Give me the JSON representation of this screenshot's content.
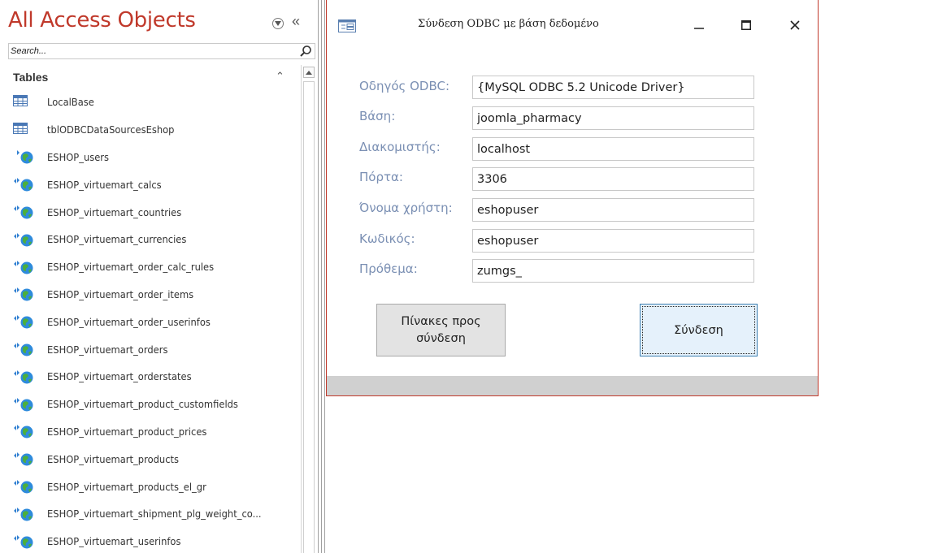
{
  "nav": {
    "title": "All Access Objects",
    "search_placeholder": "Search...",
    "group_header": "Tables",
    "items": [
      {
        "label": "LocalBase",
        "kind": "local-table"
      },
      {
        "label": "tblODBCDataSourcesEshop",
        "kind": "local-table"
      },
      {
        "label": "ESHOP_users",
        "kind": "linked-odbc-table"
      },
      {
        "label": "ESHOP_virtuemart_calcs",
        "kind": "linked-odbc-table"
      },
      {
        "label": "ESHOP_virtuemart_countries",
        "kind": "linked-odbc-table"
      },
      {
        "label": "ESHOP_virtuemart_currencies",
        "kind": "linked-odbc-table"
      },
      {
        "label": "ESHOP_virtuemart_order_calc_rules",
        "kind": "linked-odbc-table"
      },
      {
        "label": "ESHOP_virtuemart_order_items",
        "kind": "linked-odbc-table"
      },
      {
        "label": "ESHOP_virtuemart_order_userinfos",
        "kind": "linked-odbc-table"
      },
      {
        "label": "ESHOP_virtuemart_orders",
        "kind": "linked-odbc-table"
      },
      {
        "label": "ESHOP_virtuemart_orderstates",
        "kind": "linked-odbc-table"
      },
      {
        "label": "ESHOP_virtuemart_product_customfields",
        "kind": "linked-odbc-table"
      },
      {
        "label": "ESHOP_virtuemart_product_prices",
        "kind": "linked-odbc-table"
      },
      {
        "label": "ESHOP_virtuemart_products",
        "kind": "linked-odbc-table"
      },
      {
        "label": "ESHOP_virtuemart_products_el_gr",
        "kind": "linked-odbc-table"
      },
      {
        "label": "ESHOP_virtuemart_shipment_plg_weight_co...",
        "kind": "linked-odbc-table"
      },
      {
        "label": "ESHOP_virtuemart_userinfos",
        "kind": "linked-odbc-table"
      }
    ]
  },
  "form": {
    "title": "Σύνδεση ODBC με βάση δεδομένο",
    "fields": {
      "driver": {
        "label": "Οδηγός ODBC:",
        "value": "{MySQL ODBC 5.2 Unicode Driver}"
      },
      "database": {
        "label": "Βάση:",
        "value": "joomla_pharmacy"
      },
      "server": {
        "label": "Διακομιστής:",
        "value": "localhost"
      },
      "port": {
        "label": "Πόρτα:",
        "value": "3306"
      },
      "username": {
        "label": "Όνομα χρήστη:",
        "value": "eshopuser"
      },
      "password": {
        "label": "Κωδικός:",
        "value": "eshopuser"
      },
      "prefix": {
        "label": "Πρόθεμα:",
        "value": "zumgs_"
      }
    },
    "buttons": {
      "tables_to_link": "Πίνακες προς σύνδεση",
      "connect": "Σύνδεση"
    }
  },
  "colors": {
    "nav_title": "#c0392b",
    "form_border": "#c0392b",
    "field_label": "#7a8fb3",
    "default_button_border": "#3c7fb1"
  }
}
